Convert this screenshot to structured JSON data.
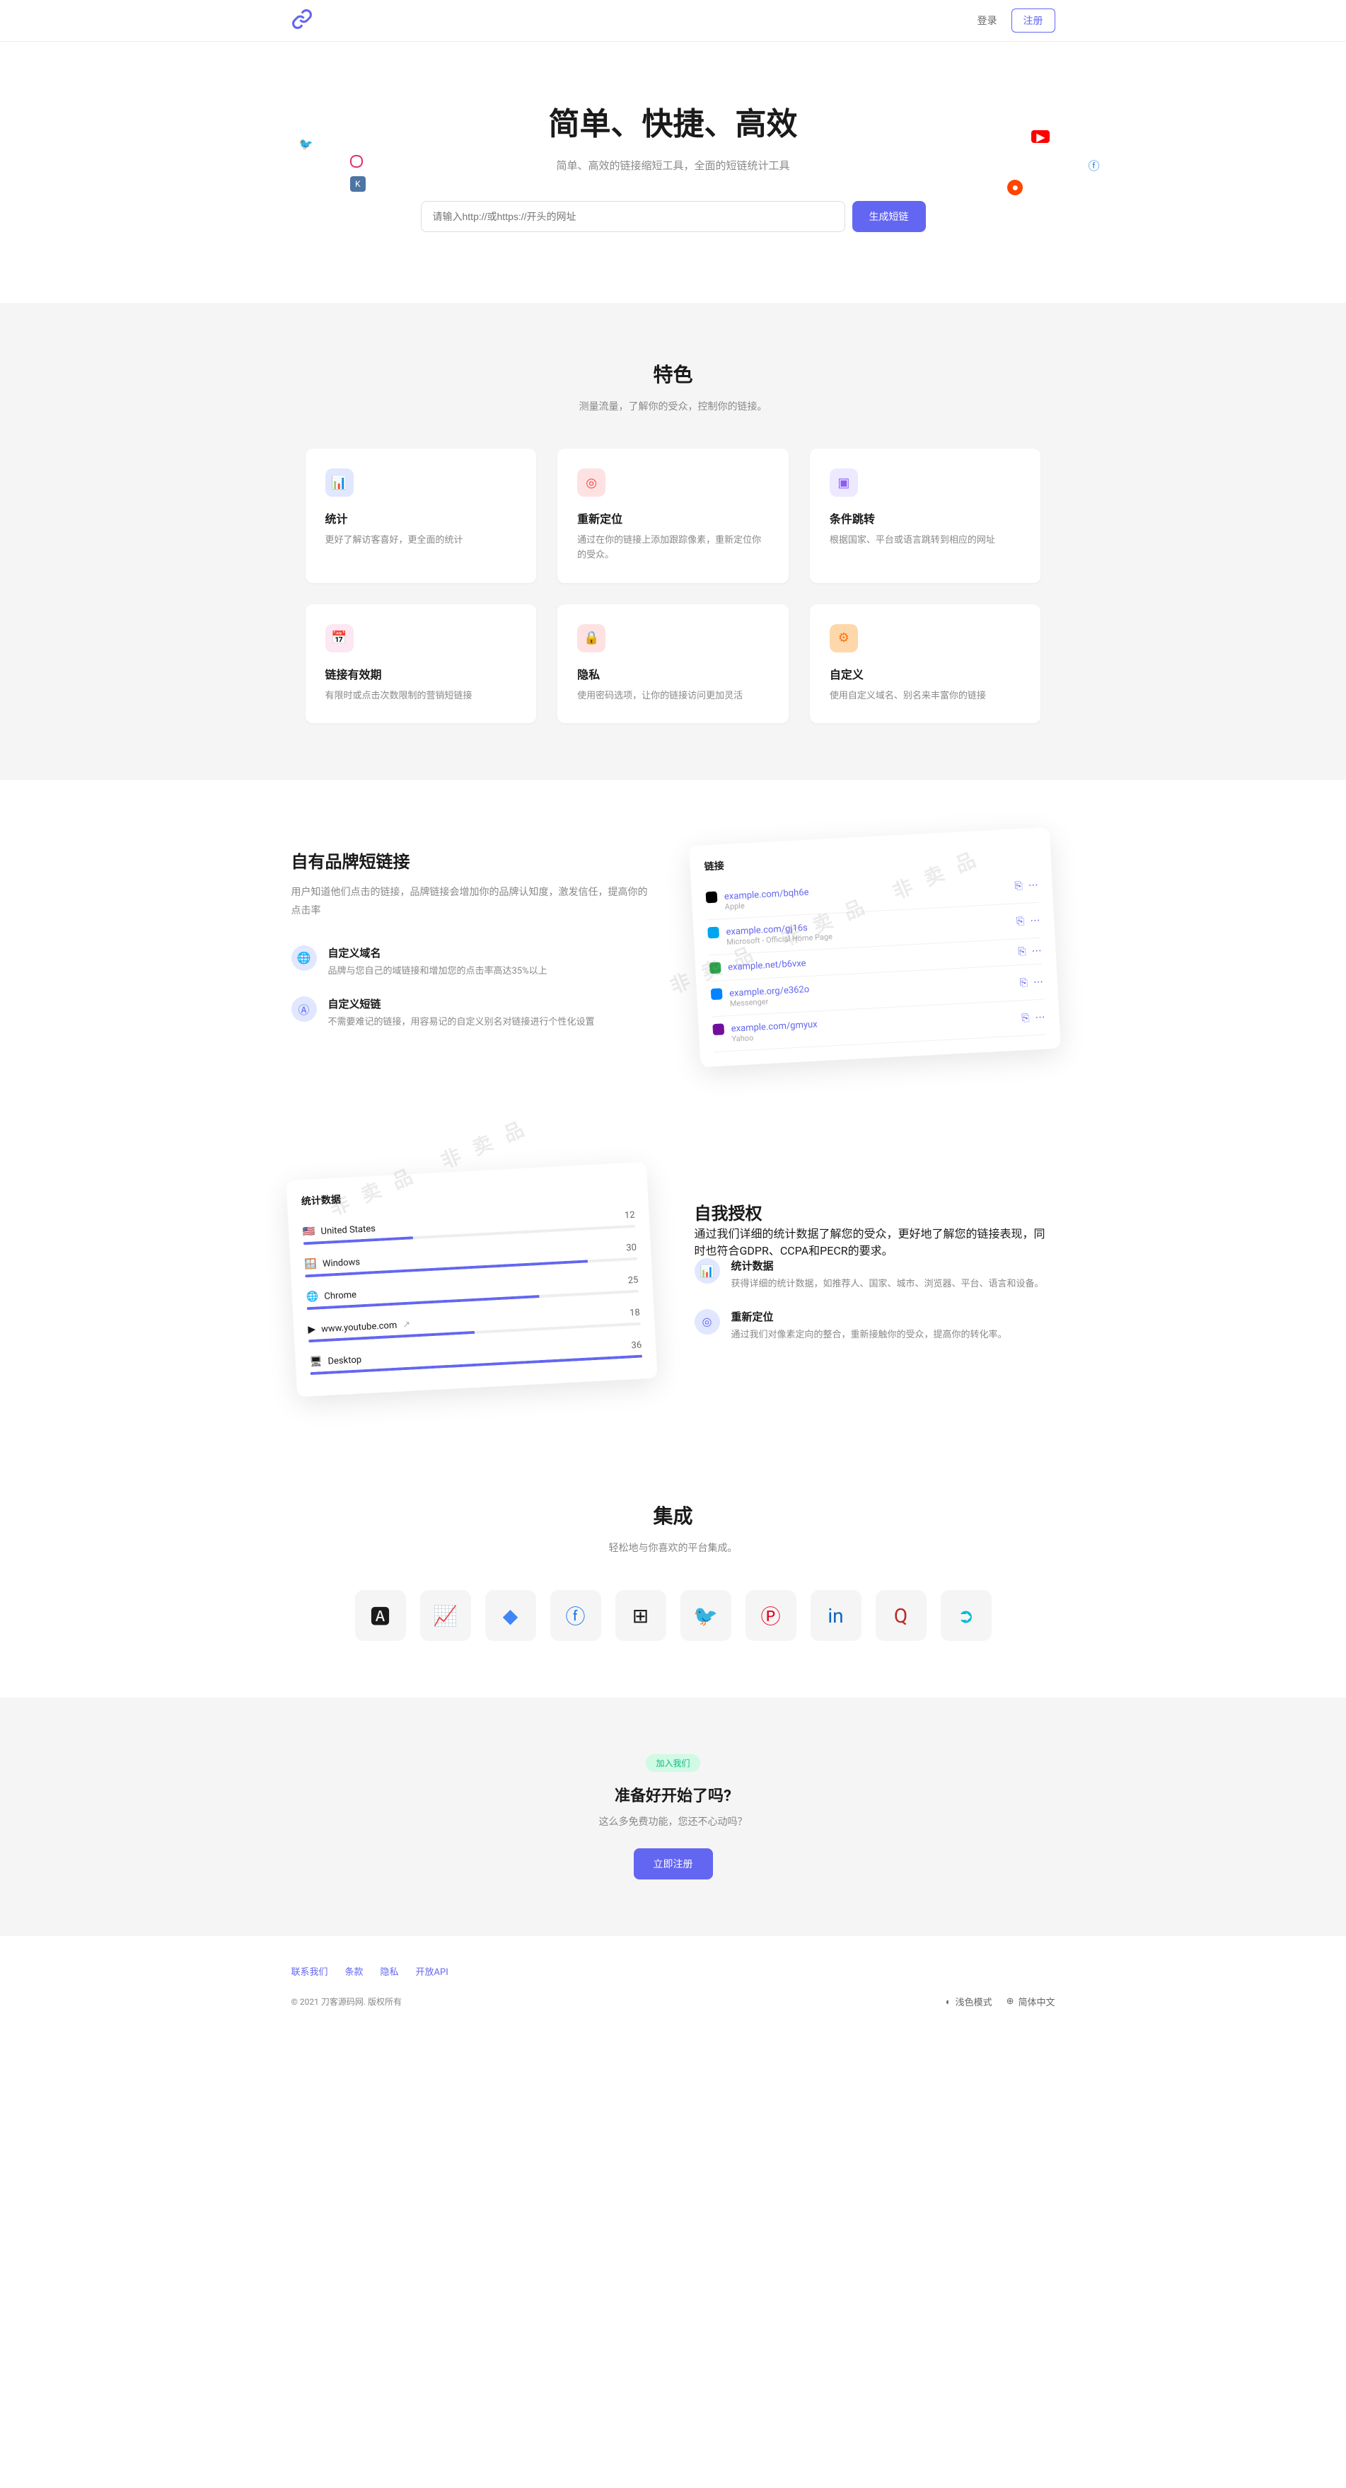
{
  "header": {
    "login": "登录",
    "register": "注册"
  },
  "hero": {
    "title": "简单、快捷、高效",
    "subtitle": "简单、高效的链接缩短工具，全面的短链统计工具",
    "placeholder": "请输入http://或https://开头的网址",
    "button": "生成短链"
  },
  "features": {
    "title": "特色",
    "subtitle": "测量流量，了解你的受众，控制你的链接。",
    "items": [
      {
        "title": "统计",
        "desc": "更好了解访客喜好，更全面的统计"
      },
      {
        "title": "重新定位",
        "desc": "通过在你的链接上添加跟踪像素，重新定位你的受众。"
      },
      {
        "title": "条件跳转",
        "desc": "根据国家、平台或语言跳转到相应的网址"
      },
      {
        "title": "链接有效期",
        "desc": "有限时或点击次数限制的营销短链接"
      },
      {
        "title": "隐私",
        "desc": "使用密码选项，让你的链接访问更加灵活"
      },
      {
        "title": "自定义",
        "desc": "使用自定义域名、别名来丰富你的链接"
      }
    ]
  },
  "brand": {
    "title": "自有品牌短链接",
    "desc": "用户知道他们点击的链接，品牌链接会增加你的品牌认知度，激发信任，提高你的点击率",
    "items": [
      {
        "title": "自定义域名",
        "desc": "品牌与您自己的域链接和增加您的点击率高达35%以上"
      },
      {
        "title": "自定义短链",
        "desc": "不需要难记的链接，用容易记的自定义别名对链接进行个性化设置"
      }
    ],
    "mock": {
      "title": "链接",
      "rows": [
        {
          "link": "example.com/bqh6e",
          "sub": "Apple"
        },
        {
          "link": "example.com/gj16s",
          "sub": "Microsoft - Official Home Page"
        },
        {
          "link": "example.net/b6vxe",
          "sub": ""
        },
        {
          "link": "example.org/e362o",
          "sub": "Messenger"
        },
        {
          "link": "example.com/gmyux",
          "sub": "Yahoo"
        }
      ]
    }
  },
  "authSec": {
    "title": "自我授权",
    "desc": "通过我们详细的统计数据了解您的受众，更好地了解您的链接表现，同时也符合GDPR、CCPA和PECR的要求。",
    "items": [
      {
        "title": "统计数据",
        "desc": "获得详细的统计数据，如推荐人、国家、城市、浏览器、平台、语言和设备。"
      },
      {
        "title": "重新定位",
        "desc": "通过我们对像素定向的整合，重新接触你的受众，提高你的转化率。"
      }
    ],
    "stats": {
      "title": "统计数据",
      "rows": [
        {
          "label": "United States",
          "emoji": "🇺🇸",
          "val": "12",
          "pct": 33
        },
        {
          "label": "Windows",
          "emoji": "🪟",
          "val": "30",
          "pct": 85
        },
        {
          "label": "Chrome",
          "emoji": "🌐",
          "val": "25",
          "pct": 70
        },
        {
          "label": "www.youtube.com",
          "emoji": "▶",
          "val": "18",
          "pct": 50,
          "ext": "↗"
        },
        {
          "label": "Desktop",
          "emoji": "🖥",
          "val": "36",
          "pct": 100
        }
      ]
    }
  },
  "integrations": {
    "title": "集成",
    "subtitle": "轻松地与你喜欢的平台集成。"
  },
  "cta": {
    "badge": "加入我们",
    "title": "准备好开始了吗?",
    "desc": "这么多免费功能，您还不心动吗？",
    "button": "立即注册"
  },
  "footer": {
    "links": [
      "联系我们",
      "条款",
      "隐私",
      "开放API"
    ],
    "copy": "© 2021 刀客源码网. 版权所有",
    "darkmode": "浅色模式",
    "lang": "简体中文"
  }
}
